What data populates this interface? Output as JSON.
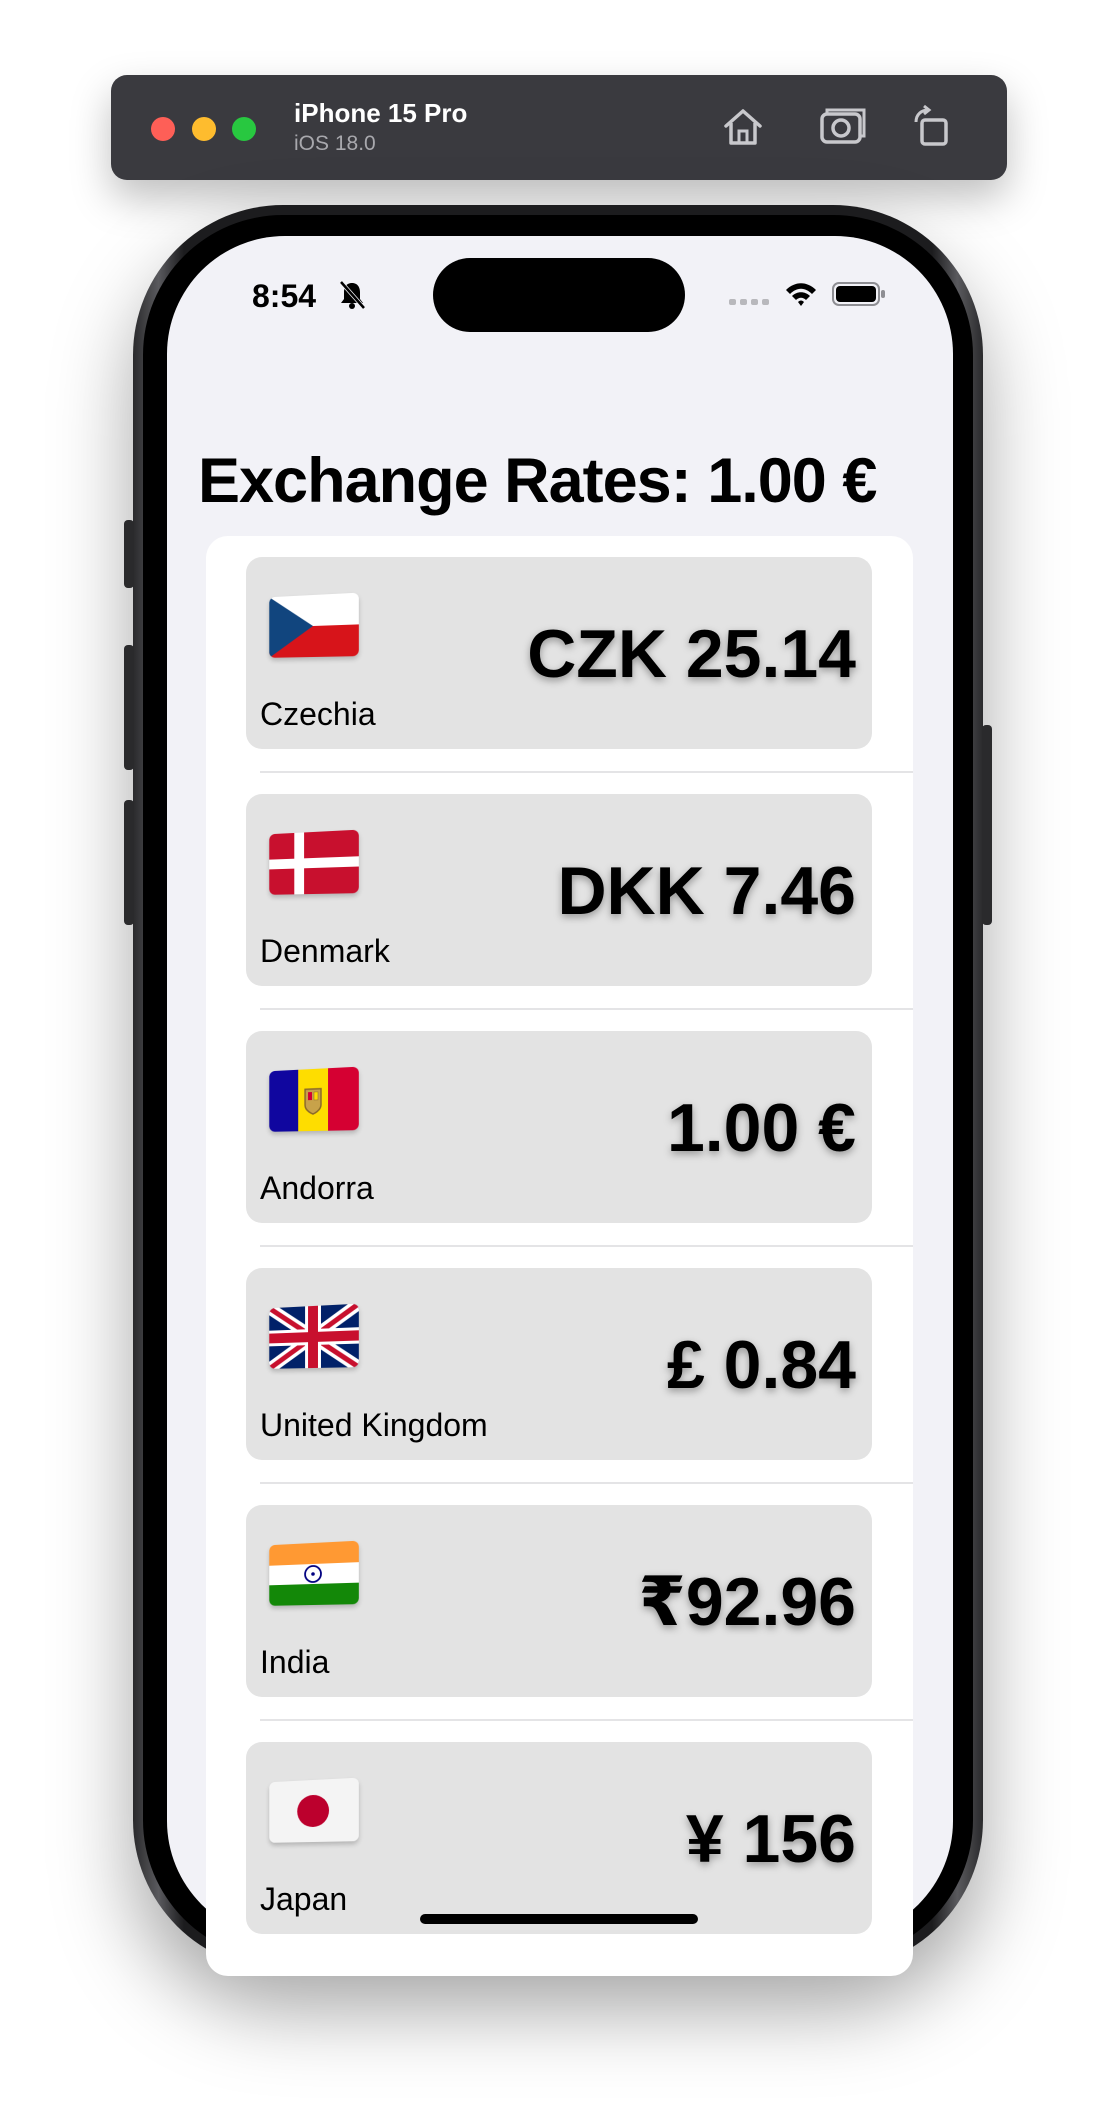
{
  "simulator": {
    "device_name": "iPhone 15 Pro",
    "os_version": "iOS 18.0",
    "icons": [
      "home-icon",
      "screenshot-icon",
      "rotate-icon"
    ]
  },
  "status_bar": {
    "time": "8:54",
    "icons": [
      "bell-slash-icon",
      "cellular-icon",
      "wifi-icon",
      "battery-icon"
    ]
  },
  "screen": {
    "title": "Exchange Rates: 1.00 €",
    "rows": [
      {
        "country": "Czechia",
        "rate": "CZK 25.14",
        "flag": "flag-czechia-icon"
      },
      {
        "country": "Denmark",
        "rate": "DKK 7.46",
        "flag": "flag-denmark-icon"
      },
      {
        "country": "Andorra",
        "rate": "1.00 €",
        "flag": "flag-andorra-icon"
      },
      {
        "country": "United Kingdom",
        "rate": "£ 0.84",
        "flag": "flag-uk-icon"
      },
      {
        "country": "India",
        "rate": "₹92.96",
        "flag": "flag-india-icon"
      },
      {
        "country": "Japan",
        "rate": "¥ 156",
        "flag": "flag-japan-icon"
      }
    ]
  },
  "colors": {
    "background": "#f2f2f7",
    "row_background": "#e3e3e3",
    "toolbar": "#3a3a3f"
  }
}
